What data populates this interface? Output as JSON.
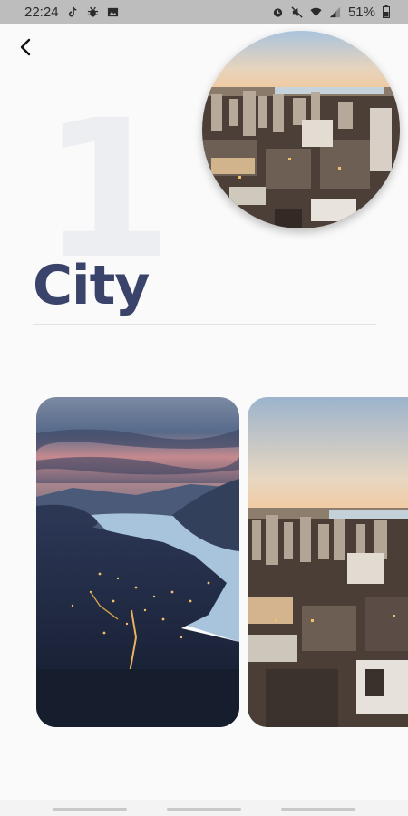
{
  "status_bar": {
    "time": "22:24",
    "battery": "51%",
    "left_icons": [
      "tiktok-icon",
      "bug-icon",
      "image-icon"
    ],
    "right_icons": [
      "alarm-icon",
      "mute-icon",
      "wifi-icon",
      "signal-icon",
      "battery-icon"
    ]
  },
  "header": {
    "back_icon": "chevron-left-icon"
  },
  "hero": {
    "number": "1",
    "title": "City"
  },
  "cards": [
    {
      "name": "lake-night-card"
    },
    {
      "name": "city-aerial-card"
    }
  ],
  "colors": {
    "title": "#3a4369",
    "number": "#eceef1",
    "background": "#fafafa"
  }
}
